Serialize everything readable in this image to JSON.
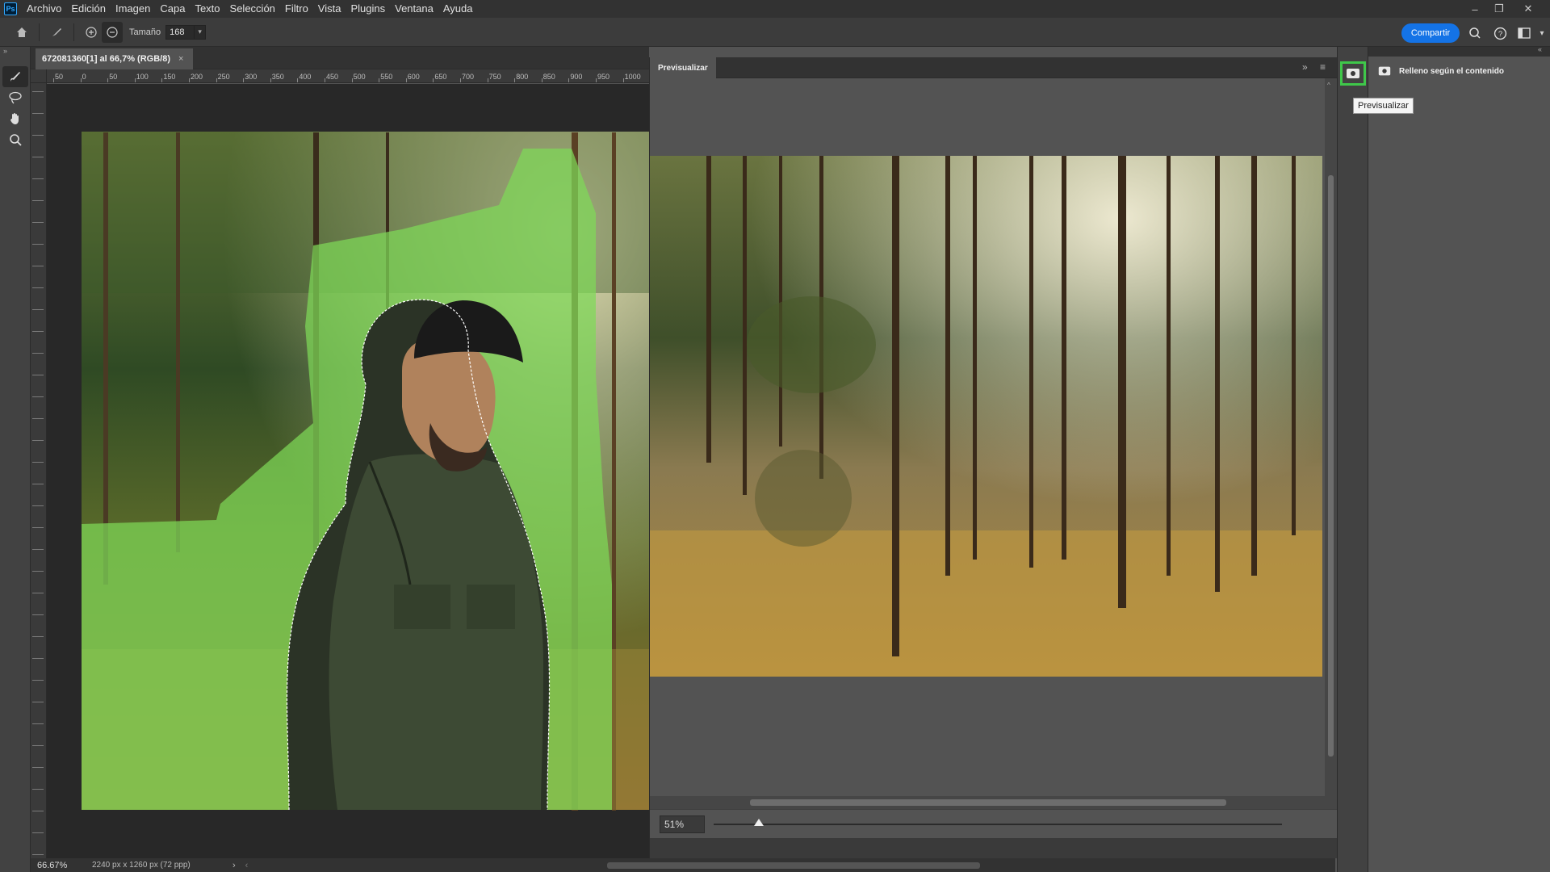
{
  "app": {
    "logo_text": "Ps"
  },
  "menu": [
    "Archivo",
    "Edición",
    "Imagen",
    "Capa",
    "Texto",
    "Selección",
    "Filtro",
    "Vista",
    "Plugins",
    "Ventana",
    "Ayuda"
  ],
  "options": {
    "size_label": "Tamaño",
    "size_value": "168",
    "share_label": "Compartir"
  },
  "document": {
    "tab_title": "672081360[1] al 66,7% (RGB/8)",
    "close_glyph": "×"
  },
  "ruler_marks": [
    "50",
    "0",
    "50",
    "100",
    "150",
    "200",
    "250",
    "300",
    "350",
    "400",
    "450",
    "500",
    "550",
    "600",
    "650",
    "700",
    "750",
    "800",
    "850",
    "900",
    "950",
    "1000"
  ],
  "status": {
    "zoom": "66.67%",
    "doc_info": "2240 px x 1260 px (72 ppp)"
  },
  "preview": {
    "tab_label": "Previsualizar",
    "zoom_value": "51%",
    "zoom_fraction": 0.08
  },
  "right_panel": {
    "title": "Relleno según el contenido",
    "tooltip": "Previsualizar"
  },
  "colors": {
    "accent": "#1473e6",
    "highlight": "#3fc74a",
    "overlay": "#7ed957"
  }
}
